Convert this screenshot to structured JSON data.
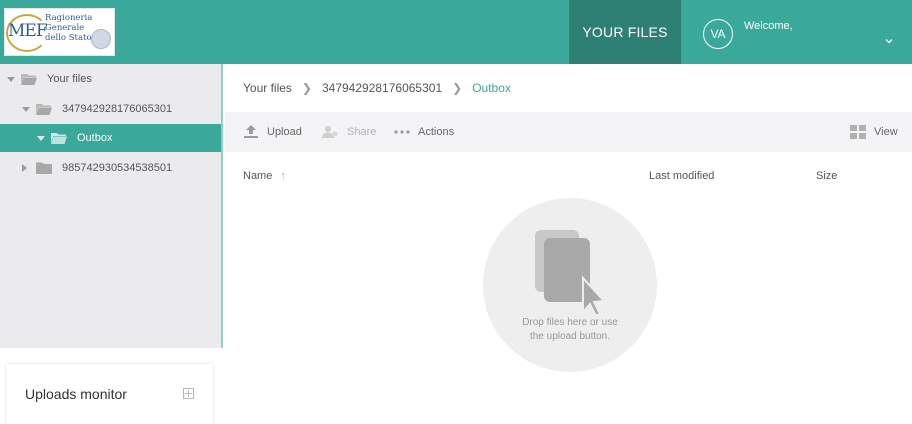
{
  "header": {
    "logo": {
      "mark": "MEF",
      "lines": [
        "Ragioneria",
        "Generale",
        "dello Stato"
      ]
    },
    "nav_active": "YOUR FILES",
    "user": {
      "initials": "VA",
      "welcome": "Welcome,"
    }
  },
  "sidebar": {
    "tree": [
      {
        "label": "Your files",
        "expanded": true,
        "level": 0
      },
      {
        "label": "347942928176065301",
        "expanded": true,
        "level": 1
      },
      {
        "label": "Outbox",
        "expanded": true,
        "level": 2,
        "selected": true
      },
      {
        "label": "985742930534538501",
        "expanded": false,
        "level": 1
      }
    ],
    "uploads_monitor": {
      "title": "Uploads monitor"
    }
  },
  "breadcrumb": [
    "Your files",
    "347942928176065301",
    "Outbox"
  ],
  "toolbar": {
    "upload": "Upload",
    "share": "Share",
    "actions": "Actions",
    "view": "View"
  },
  "table": {
    "columns": {
      "name": "Name",
      "last_modified": "Last modified",
      "size": "Size"
    },
    "sort_indicator": "↑"
  },
  "dropzone": {
    "line1": "Drop files here or use",
    "line2": "the upload button."
  },
  "colors": {
    "accent": "#3aa99b",
    "accent_dark": "#2e7f74",
    "sidebar_bg": "#ebebee"
  }
}
